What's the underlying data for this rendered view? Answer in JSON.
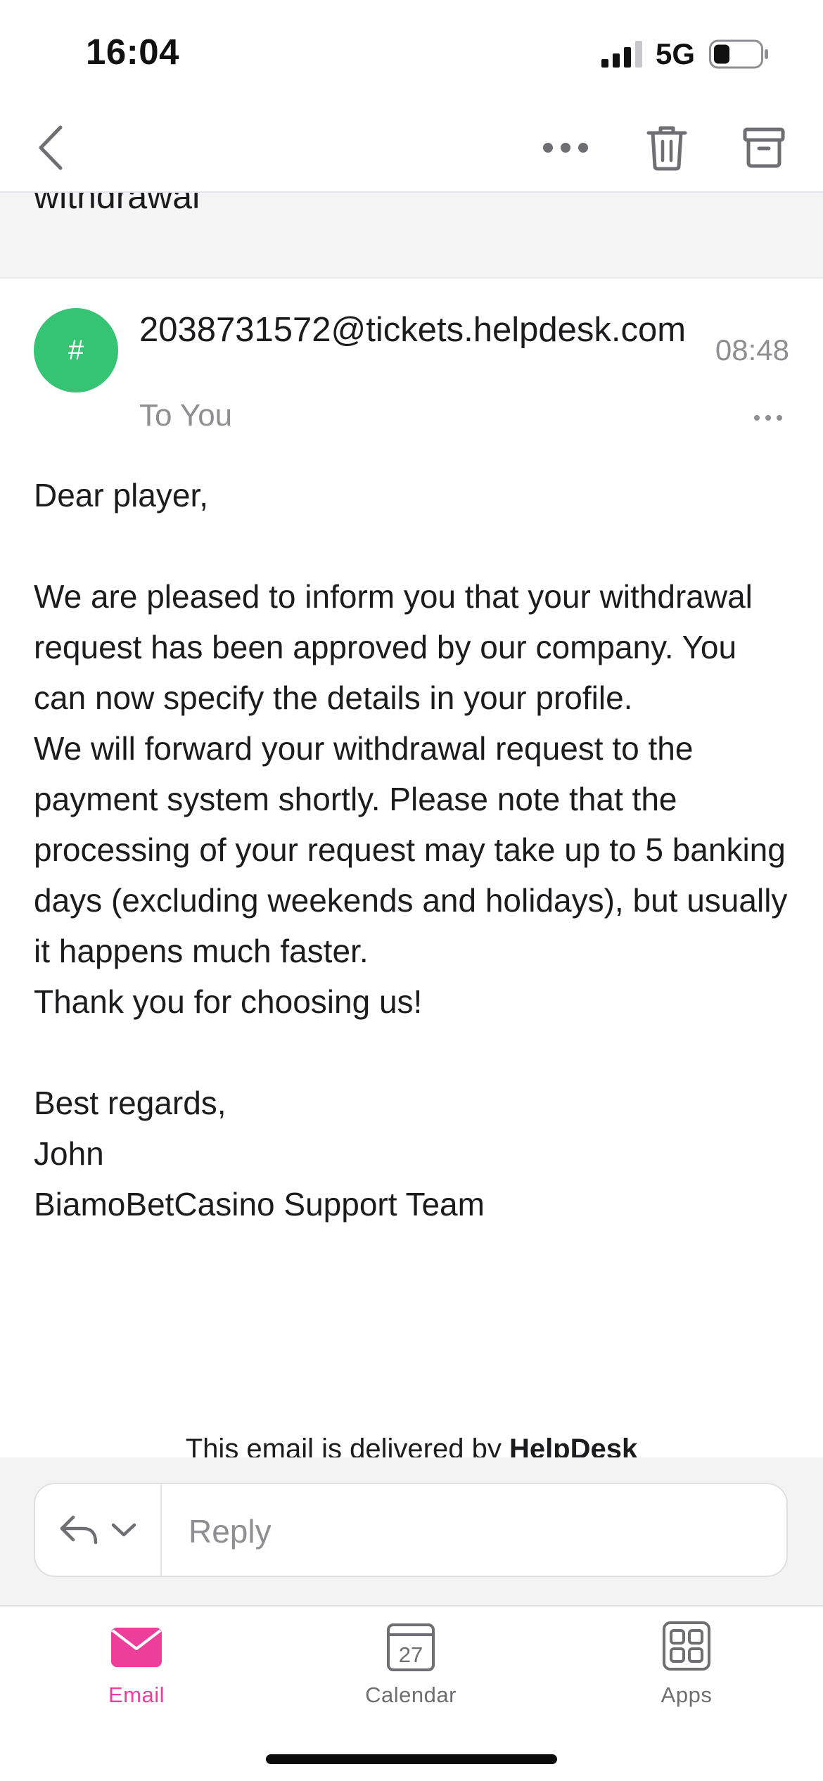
{
  "status_bar": {
    "time": "16:04",
    "network": "5G",
    "icons": [
      "signal-icon",
      "battery-icon"
    ]
  },
  "nav": {
    "icons": [
      "back-chevron-icon",
      "more-horizontal-icon",
      "trash-icon",
      "archive-icon"
    ]
  },
  "message": {
    "subject_fragment": "withdrawal",
    "avatar_initial": "#",
    "avatar_color": "#34c474",
    "sender": "2038731572@tickets.helpdesk.com",
    "recipient": "To You",
    "time": "08:48",
    "body": {
      "greeting": "Dear player,",
      "para1": "We are pleased to inform you that your withdrawal request has been approved by our company. You can now specify the details in your profile.",
      "para2": "We will forward your withdrawal request to the payment system shortly. Please note that the processing of your request may take up to 5 banking days (excluding weekends and holidays), but usually it happens much faster.",
      "para3": "Thank you for choosing us!",
      "signoff": "Best regards,",
      "signer": "John",
      "team": "BiamoBetCasino Support Team"
    },
    "footer_prefix": "This email is delivered by ",
    "footer_brand": "HelpDesk"
  },
  "reply": {
    "placeholder": "Reply",
    "icons": [
      "reply-arrow-icon",
      "chevron-down-icon"
    ]
  },
  "tabs": [
    {
      "label": "Email",
      "icon": "email-icon",
      "active": true
    },
    {
      "label": "Calendar",
      "icon": "calendar-icon",
      "day": "27",
      "active": false
    },
    {
      "label": "Apps",
      "icon": "apps-grid-icon",
      "active": false
    }
  ],
  "colors": {
    "accent": "#ee3e9c",
    "avatar": "#34c474",
    "secondary_text": "#8e8e93"
  }
}
